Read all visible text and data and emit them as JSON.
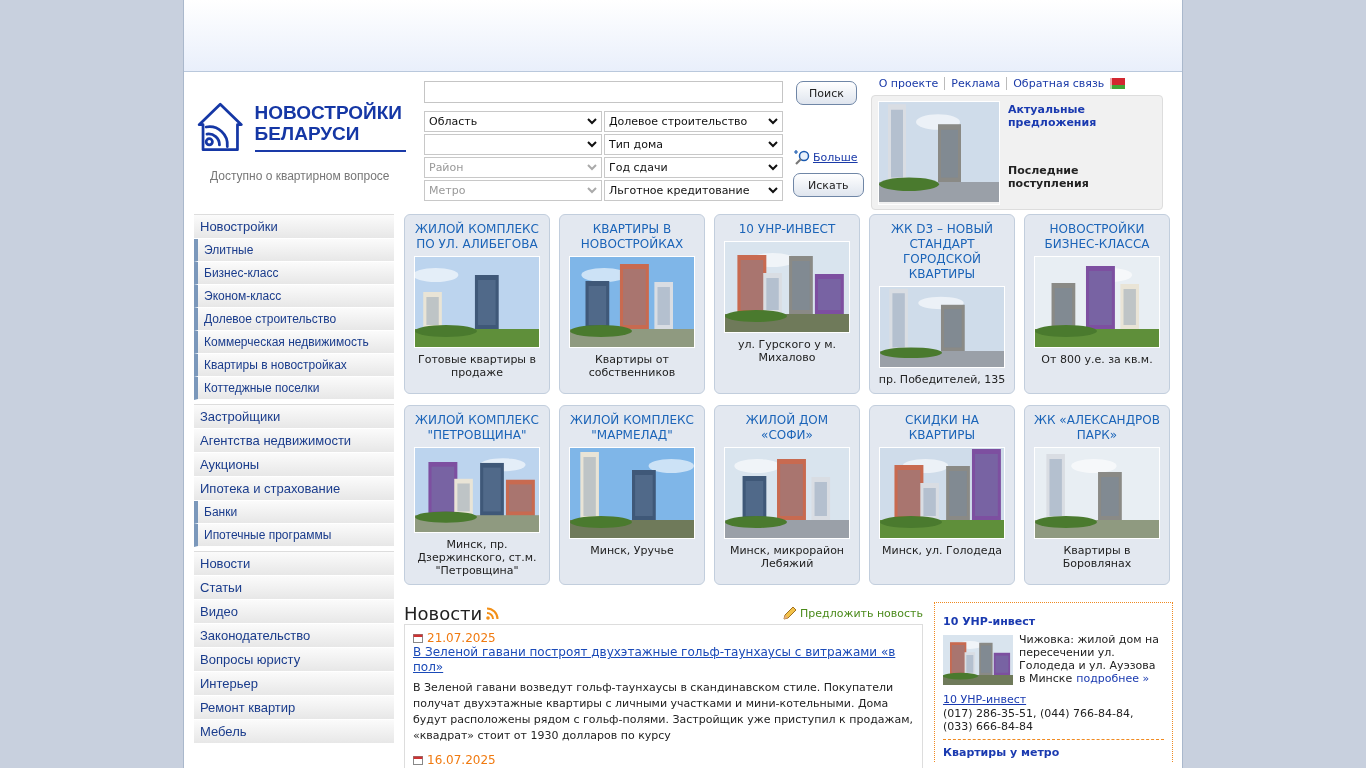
{
  "logo": {
    "title_lines": [
      "НОВОСТРОЙКИ",
      "БЕЛАРУСИ"
    ],
    "tagline": "Доступно о квартирном вопросе"
  },
  "search": {
    "search_button": "Поиск",
    "filters_left": [
      {
        "value": "Область",
        "disabled": false
      },
      {
        "disabled": false
      },
      {
        "value": "Район",
        "disabled": true
      },
      {
        "value": "Метро",
        "disabled": true
      }
    ],
    "filters_right": [
      {
        "value": "Долевое строительство",
        "disabled": false
      },
      {
        "value": "Тип дома",
        "disabled": false
      },
      {
        "value": "Год сдачи",
        "disabled": false
      },
      {
        "value": "Льготное кредитование",
        "disabled": false
      }
    ],
    "more_link": "Больше",
    "submit_button": "Искать"
  },
  "top_links": [
    "О проекте",
    "Реклама",
    "Обратная связь"
  ],
  "promo": {
    "kind": "picture",
    "links": [
      {
        "text": "Актуальные предложения",
        "kind": "link"
      },
      {
        "text": "Последние поступления",
        "kind": "plain"
      }
    ]
  },
  "menu": [
    [
      {
        "label": "Новостройки",
        "children": [
          {
            "label": "Элитные"
          },
          {
            "label": "Бизнес-класс"
          },
          {
            "label": "Эконом-класс"
          },
          {
            "label": "Долевое строительство"
          },
          {
            "label": "Коммерческая недвижимость"
          },
          {
            "label": "Квартиры в новостройках"
          },
          {
            "label": "Коттеджные поселки"
          }
        ]
      }
    ],
    [
      {
        "label": "Застройщики"
      },
      {
        "label": "Агентства недвижимости"
      },
      {
        "label": "Аукционы"
      },
      {
        "label": "Ипотека и страхование",
        "children": [
          {
            "label": "Банки"
          },
          {
            "label": "Ипотечные программы"
          }
        ]
      }
    ],
    [
      {
        "label": "Новости"
      },
      {
        "label": "Статьи"
      },
      {
        "label": "Видео"
      },
      {
        "label": "Законодательство"
      },
      {
        "label": "Вопросы юристу"
      },
      {
        "label": "Интерьер"
      },
      {
        "label": "Ремонт квартир"
      },
      {
        "label": "Мебель"
      }
    ]
  ],
  "cards": [
    {
      "title": "ЖИЛОЙ КОМПЛЕКС ПО УЛ. АЛИБЕГОВА",
      "caption": "Готовые квартиры в продаже"
    },
    {
      "title": "КВАРТИРЫ В НОВОСТРОЙКАХ",
      "caption": "Квартиры от собственников"
    },
    {
      "title": "10 УНР-ИНВЕСТ",
      "caption": "ул. Гурского у м. Михалово"
    },
    {
      "title": "ЖК D3 – НОВЫЙ СТАНДАРТ ГОРОДСКОЙ КВАРТИРЫ",
      "caption": "пр. Победителей, 135"
    },
    {
      "title": "НОВОСТРОЙКИ БИЗНЕС-КЛАССА",
      "caption": "От 800 у.е. за кв.м."
    },
    {
      "title": "ЖИЛОЙ КОМПЛЕКС \"ПЕТРОВЩИНА\"",
      "caption": "Минск, пр. Дзержинского, ст.м. \"Петровщина\""
    },
    {
      "title": "ЖИЛОЙ КОМПЛЕКС \"МАРМЕЛАД\"",
      "caption": "Минск, Уручье"
    },
    {
      "title": "ЖИЛОЙ ДОМ «СОФИ»",
      "caption": "Минск, микрорайон Лебяжий"
    },
    {
      "title": "СКИДКИ НА КВАРТИРЫ",
      "caption": "Минск, ул. Голодеда"
    },
    {
      "title": "ЖК «АЛЕКСАНДРОВ ПАРК»",
      "caption": "Квартиры в Боровлянах"
    }
  ],
  "news": {
    "title": "Новости",
    "suggest_link": "Предложить новость",
    "items": [
      {
        "date": "21.07.2025",
        "title": "В Зеленой гавани построят двухэтажные гольф-таунхаусы с витражами «в пол»",
        "text": "В Зеленой гавани возведут гольф-таунхаусы в скандинавском стиле. Покупатели получат двухэтажные квартиры с личными участками и мини-котельными. Дома будут расположены рядом с гольф-полями. Застройщик уже приступил к продажам, «квадрат» стоит от 1930 долларов по курсу"
      },
      {
        "date": "16.07.2025"
      }
    ]
  },
  "side_panel": {
    "title": "10 УНР-инвест",
    "text": "Чижовка: жилой дом на пересечении ул. Голодеда и ул. Ауэзова в Минске",
    "more_link": "подробнее »",
    "company_link": "10 УНР-инвест",
    "phones": "(017) 286-35-51, (044) 766-84-84, (033) 666-84-84",
    "next_title": "Квартиры у метро"
  }
}
